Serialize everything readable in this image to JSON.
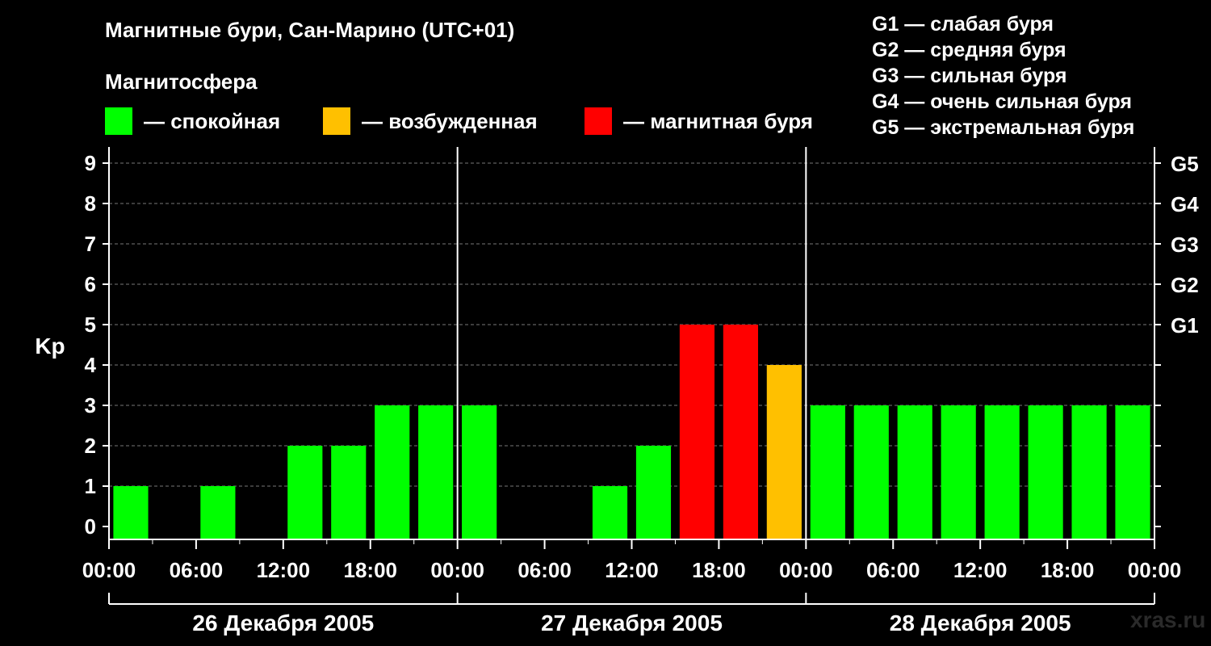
{
  "title": "Магнитные бури, Сан-Марино (UTC+01)",
  "subtitle": "Магнитосфера",
  "legend": [
    {
      "label": "— спокойная",
      "color": "#00ff00"
    },
    {
      "label": "— возбужденная",
      "color": "#ffc000"
    },
    {
      "label": "— магнитная буря",
      "color": "#ff0000"
    }
  ],
  "g_scale": [
    "G1 — слабая буря",
    "G2 — средняя буря",
    "G3 — сильная буря",
    "G4 — очень сильная буря",
    "G5 — экстремальная буря"
  ],
  "watermark": "xras.ru",
  "chart_data": {
    "type": "bar",
    "ylabel": "Kp",
    "ylim": [
      0,
      9
    ],
    "yticks": [
      0,
      1,
      2,
      3,
      4,
      5,
      6,
      7,
      8,
      9
    ],
    "right_ticks": [
      {
        "value": 5,
        "label": "G1"
      },
      {
        "value": 6,
        "label": "G2"
      },
      {
        "value": 7,
        "label": "G3"
      },
      {
        "value": 8,
        "label": "G4"
      },
      {
        "value": 9,
        "label": "G5"
      }
    ],
    "grid": true,
    "xtick_labels": [
      "00:00",
      "06:00",
      "12:00",
      "18:00",
      "00:00",
      "06:00",
      "12:00",
      "18:00",
      "00:00",
      "06:00",
      "12:00",
      "18:00",
      "00:00"
    ],
    "days": [
      "26 Декабря 2005",
      "27 Декабря 2005",
      "28 Декабря 2005"
    ],
    "interval_hours": 3,
    "values": [
      1,
      0,
      1,
      0,
      2,
      2,
      3,
      3,
      3,
      0,
      0,
      1,
      2,
      5,
      5,
      4,
      3,
      3,
      3,
      3,
      3,
      3,
      3,
      3
    ],
    "thresholds": {
      "quiet_max": 3,
      "active": 4,
      "storm_min": 5
    },
    "colors": {
      "quiet": "#00ff00",
      "active": "#ffc000",
      "storm": "#ff0000"
    }
  }
}
